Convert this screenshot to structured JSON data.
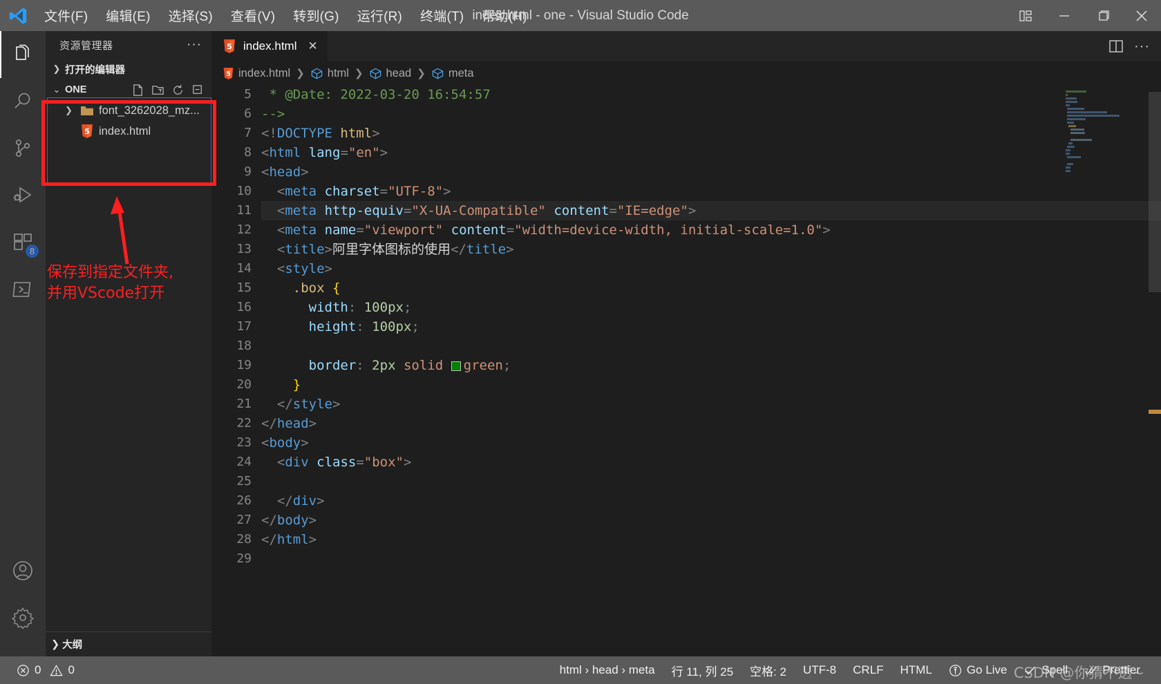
{
  "titlebar": {
    "logo_icon": "vscode-logo-icon",
    "window_title": "index.html - one - Visual Studio Code",
    "menu": [
      {
        "label": "文件(F)",
        "name": "menu-file"
      },
      {
        "label": "编辑(E)",
        "name": "menu-edit"
      },
      {
        "label": "选择(S)",
        "name": "menu-selection"
      },
      {
        "label": "查看(V)",
        "name": "menu-view"
      },
      {
        "label": "转到(G)",
        "name": "menu-go"
      },
      {
        "label": "运行(R)",
        "name": "menu-run"
      },
      {
        "label": "终端(T)",
        "name": "menu-terminal"
      },
      {
        "label": "帮助(H)",
        "name": "menu-help"
      }
    ],
    "controls": [
      {
        "name": "customize-layout-icon",
        "glyph": "layout"
      },
      {
        "name": "minimize-icon",
        "glyph": "minimize"
      },
      {
        "name": "maximize-icon",
        "glyph": "maximize"
      },
      {
        "name": "close-icon",
        "glyph": "close"
      }
    ]
  },
  "activitybar": {
    "items": [
      {
        "name": "activity-explorer",
        "icon": "files-icon",
        "active": true,
        "badge": ""
      },
      {
        "name": "activity-search",
        "icon": "search-icon",
        "active": false,
        "badge": ""
      },
      {
        "name": "activity-source-control",
        "icon": "source-control-icon",
        "active": false,
        "badge": ""
      },
      {
        "name": "activity-run-debug",
        "icon": "run-debug-icon",
        "active": false,
        "badge": ""
      },
      {
        "name": "activity-extensions",
        "icon": "extensions-icon",
        "active": false,
        "badge": "8"
      },
      {
        "name": "activity-remote",
        "icon": "remote-terminal-icon",
        "active": false,
        "badge": ""
      }
    ],
    "bottom": [
      {
        "name": "activity-accounts",
        "icon": "account-icon"
      },
      {
        "name": "activity-settings",
        "icon": "gear-icon"
      }
    ]
  },
  "sidebar": {
    "title": "资源管理器",
    "more_actions": "···",
    "sections": [
      {
        "label": "打开的编辑器",
        "expanded": false
      },
      {
        "label": "ONE",
        "expanded": true
      }
    ],
    "section_tools": [
      {
        "name": "new-file-icon"
      },
      {
        "name": "new-folder-icon"
      },
      {
        "name": "refresh-icon"
      },
      {
        "name": "collapse-all-icon"
      }
    ],
    "tree": [
      {
        "label": "font_3262028_mz...",
        "type": "folder",
        "expanded": false,
        "name": "tree-item-folder"
      },
      {
        "label": "index.html",
        "type": "html-file",
        "expanded": false,
        "name": "tree-item-file"
      }
    ],
    "outline_label": "大纲"
  },
  "annotation": {
    "text": "保存到指定文件夹,\n并用VScode打开",
    "color": "#ff1f1f"
  },
  "editor": {
    "tab": {
      "label": "index.html",
      "icon": "html5-icon",
      "close": "✕"
    },
    "tab_actions": [
      {
        "name": "split-editor-icon"
      },
      {
        "name": "more-actions-icon",
        "label": "···"
      }
    ],
    "breadcrumb": [
      {
        "label": "index.html",
        "icon": "html5-icon"
      },
      {
        "label": "html",
        "icon": "symbol-field-icon"
      },
      {
        "label": "head",
        "icon": "symbol-field-icon"
      },
      {
        "label": "meta",
        "icon": "symbol-field-icon"
      }
    ],
    "first_line_number": 5,
    "highlighted_line": 11,
    "lines": [
      {
        "n": 5,
        "indent": 0,
        "tokens": [
          {
            "c": "t-comment",
            "t": " * @Date: 2022-03-20 16:54:57"
          }
        ]
      },
      {
        "n": 6,
        "indent": 0,
        "tokens": [
          {
            "c": "t-comment",
            "t": "-->"
          }
        ]
      },
      {
        "n": 7,
        "indent": 0,
        "tokens": [
          {
            "c": "t-punc",
            "t": "<!"
          },
          {
            "c": "t-doctype",
            "t": "DOCTYPE"
          },
          {
            "c": "t-text",
            "t": " "
          },
          {
            "c": "t-dval",
            "t": "html"
          },
          {
            "c": "t-punc",
            "t": ">"
          }
        ]
      },
      {
        "n": 8,
        "indent": 0,
        "tokens": [
          {
            "c": "t-punc",
            "t": "<"
          },
          {
            "c": "t-tag",
            "t": "html"
          },
          {
            "c": "t-text",
            "t": " "
          },
          {
            "c": "t-attr",
            "t": "lang"
          },
          {
            "c": "t-punc",
            "t": "="
          },
          {
            "c": "t-str",
            "t": "\"en\""
          },
          {
            "c": "t-punc",
            "t": ">"
          }
        ]
      },
      {
        "n": 9,
        "indent": 0,
        "tokens": [
          {
            "c": "t-punc",
            "t": "<"
          },
          {
            "c": "t-tag",
            "t": "head"
          },
          {
            "c": "t-punc",
            "t": ">"
          }
        ]
      },
      {
        "n": 10,
        "indent": 1,
        "tokens": [
          {
            "c": "t-punc",
            "t": "<"
          },
          {
            "c": "t-tag",
            "t": "meta"
          },
          {
            "c": "t-text",
            "t": " "
          },
          {
            "c": "t-attr",
            "t": "charset"
          },
          {
            "c": "t-punc",
            "t": "="
          },
          {
            "c": "t-str",
            "t": "\"UTF-8\""
          },
          {
            "c": "t-punc",
            "t": ">"
          }
        ]
      },
      {
        "n": 11,
        "indent": 1,
        "tokens": [
          {
            "c": "t-punc",
            "t": "<"
          },
          {
            "c": "t-tag",
            "t": "meta"
          },
          {
            "c": "t-text",
            "t": " "
          },
          {
            "c": "t-attr",
            "t": "http-equiv"
          },
          {
            "c": "t-punc",
            "t": "="
          },
          {
            "c": "t-str",
            "t": "\"X-UA-Compatible\""
          },
          {
            "c": "t-text",
            "t": " "
          },
          {
            "c": "t-attr",
            "t": "content"
          },
          {
            "c": "t-punc",
            "t": "="
          },
          {
            "c": "t-str",
            "t": "\"IE=edge\""
          },
          {
            "c": "t-punc",
            "t": ">"
          }
        ]
      },
      {
        "n": 12,
        "indent": 1,
        "tokens": [
          {
            "c": "t-punc",
            "t": "<"
          },
          {
            "c": "t-tag",
            "t": "meta"
          },
          {
            "c": "t-text",
            "t": " "
          },
          {
            "c": "t-attr",
            "t": "name"
          },
          {
            "c": "t-punc",
            "t": "="
          },
          {
            "c": "t-str",
            "t": "\"viewport\""
          },
          {
            "c": "t-text",
            "t": " "
          },
          {
            "c": "t-attr",
            "t": "content"
          },
          {
            "c": "t-punc",
            "t": "="
          },
          {
            "c": "t-str",
            "t": "\"width=device-width, initial-scale=1.0\""
          },
          {
            "c": "t-punc",
            "t": ">"
          }
        ]
      },
      {
        "n": 13,
        "indent": 1,
        "tokens": [
          {
            "c": "t-punc",
            "t": "<"
          },
          {
            "c": "t-tag",
            "t": "title"
          },
          {
            "c": "t-punc",
            "t": ">"
          },
          {
            "c": "t-text",
            "t": "阿里字体图标的使用"
          },
          {
            "c": "t-punc",
            "t": "</"
          },
          {
            "c": "t-tag",
            "t": "title"
          },
          {
            "c": "t-punc",
            "t": ">"
          }
        ]
      },
      {
        "n": 14,
        "indent": 1,
        "tokens": [
          {
            "c": "t-punc",
            "t": "<"
          },
          {
            "c": "t-tag",
            "t": "style"
          },
          {
            "c": "t-punc",
            "t": ">"
          }
        ]
      },
      {
        "n": 15,
        "indent": 2,
        "tokens": [
          {
            "c": "t-sel",
            "t": ".box"
          },
          {
            "c": "t-text",
            "t": " "
          },
          {
            "c": "t-brace",
            "t": "{"
          }
        ]
      },
      {
        "n": 16,
        "indent": 3,
        "tokens": [
          {
            "c": "t-prop",
            "t": "width"
          },
          {
            "c": "t-punc",
            "t": ": "
          },
          {
            "c": "t-num",
            "t": "100"
          },
          {
            "c": "t-unit",
            "t": "px"
          },
          {
            "c": "t-punc",
            "t": ";"
          }
        ]
      },
      {
        "n": 17,
        "indent": 3,
        "tokens": [
          {
            "c": "t-prop",
            "t": "height"
          },
          {
            "c": "t-punc",
            "t": ": "
          },
          {
            "c": "t-num",
            "t": "100"
          },
          {
            "c": "t-unit",
            "t": "px"
          },
          {
            "c": "t-punc",
            "t": ";"
          }
        ]
      },
      {
        "n": 18,
        "indent": 3,
        "tokens": []
      },
      {
        "n": 19,
        "indent": 3,
        "tokens": [
          {
            "c": "t-prop",
            "t": "border"
          },
          {
            "c": "t-punc",
            "t": ": "
          },
          {
            "c": "t-num",
            "t": "2"
          },
          {
            "c": "t-unit",
            "t": "px"
          },
          {
            "c": "t-text",
            "t": " "
          },
          {
            "c": "t-css-kw",
            "t": "solid"
          },
          {
            "c": "t-text",
            "t": " "
          },
          {
            "c": "swatch",
            "t": "green"
          },
          {
            "c": "t-punc",
            "t": ";"
          }
        ]
      },
      {
        "n": 20,
        "indent": 2,
        "tokens": [
          {
            "c": "t-brace",
            "t": "}"
          }
        ]
      },
      {
        "n": 21,
        "indent": 1,
        "tokens": [
          {
            "c": "t-punc",
            "t": "</"
          },
          {
            "c": "t-tag",
            "t": "style"
          },
          {
            "c": "t-punc",
            "t": ">"
          }
        ]
      },
      {
        "n": 22,
        "indent": 0,
        "tokens": [
          {
            "c": "t-punc",
            "t": "</"
          },
          {
            "c": "t-tag",
            "t": "head"
          },
          {
            "c": "t-punc",
            "t": ">"
          }
        ]
      },
      {
        "n": 23,
        "indent": 0,
        "tokens": [
          {
            "c": "t-punc",
            "t": "<"
          },
          {
            "c": "t-tag",
            "t": "body"
          },
          {
            "c": "t-punc",
            "t": ">"
          }
        ]
      },
      {
        "n": 24,
        "indent": 1,
        "tokens": [
          {
            "c": "t-punc",
            "t": "<"
          },
          {
            "c": "t-tag",
            "t": "div"
          },
          {
            "c": "t-text",
            "t": " "
          },
          {
            "c": "t-attr",
            "t": "class"
          },
          {
            "c": "t-punc",
            "t": "="
          },
          {
            "c": "t-str",
            "t": "\"box\""
          },
          {
            "c": "t-punc",
            "t": ">"
          }
        ]
      },
      {
        "n": 25,
        "indent": 1,
        "tokens": []
      },
      {
        "n": 26,
        "indent": 1,
        "tokens": [
          {
            "c": "t-punc",
            "t": "</"
          },
          {
            "c": "t-tag",
            "t": "div"
          },
          {
            "c": "t-punc",
            "t": ">"
          }
        ]
      },
      {
        "n": 27,
        "indent": 0,
        "tokens": [
          {
            "c": "t-punc",
            "t": "</"
          },
          {
            "c": "t-tag",
            "t": "body"
          },
          {
            "c": "t-punc",
            "t": ">"
          }
        ]
      },
      {
        "n": 28,
        "indent": 0,
        "tokens": [
          {
            "c": "t-punc",
            "t": "</"
          },
          {
            "c": "t-tag",
            "t": "html"
          },
          {
            "c": "t-punc",
            "t": ">"
          }
        ]
      },
      {
        "n": 29,
        "indent": 0,
        "tokens": []
      }
    ]
  },
  "statusbar": {
    "errors": "0",
    "warnings": "0",
    "breadcrumb": "html › head › meta",
    "cursor": "行 11, 列 25",
    "indent": "空格: 2",
    "encoding": "UTF-8",
    "eol": "CRLF",
    "language": "HTML",
    "golive": "Go Live",
    "spell": "Spell",
    "prettier": "Prettier",
    "watermark": "CSDN @你猜不透~"
  },
  "colors": {
    "titlebar_bg": "#5a5a5a",
    "activitybar_bg": "#333333",
    "sidebar_bg": "#252526",
    "editor_bg": "#1e1e1e",
    "accent_red": "#ff1f1f",
    "badge_blue": "#1f6feb",
    "css_green": "#008000"
  }
}
